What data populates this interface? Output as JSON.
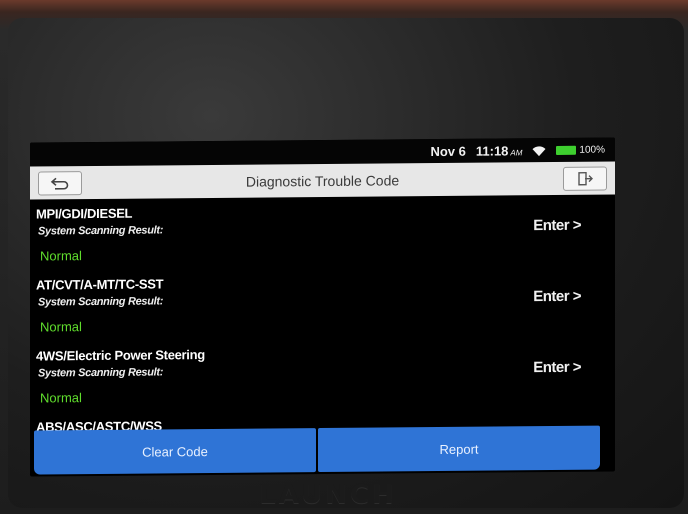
{
  "status": {
    "date": "Nov 6",
    "time": "11:18",
    "ampm": "AM",
    "battery": "100%"
  },
  "header": {
    "title": "Diagnostic Trouble Code",
    "back_icon": "back-arrow-icon",
    "exit_icon": "exit-icon"
  },
  "systems": [
    {
      "name": "MPI/GDI/DIESEL",
      "label": "System Scanning Result:",
      "result": "Normal",
      "action": "Enter >"
    },
    {
      "name": "AT/CVT/A-MT/TC-SST",
      "label": "System Scanning Result:",
      "result": "Normal",
      "action": "Enter >"
    },
    {
      "name": "4WS/Electric Power Steering",
      "label": "System Scanning Result:",
      "result": "Normal",
      "action": "Enter >"
    },
    {
      "name": "ABS/ASC/ASTC/WSS"
    }
  ],
  "footer": {
    "clear_label": "Clear Code",
    "report_label": "Report"
  },
  "device": {
    "brand": "LAUNCH"
  },
  "colors": {
    "result_green": "#5fdc2c",
    "button_blue": "#2f74d6",
    "title_bar": "#e7e7e7"
  }
}
